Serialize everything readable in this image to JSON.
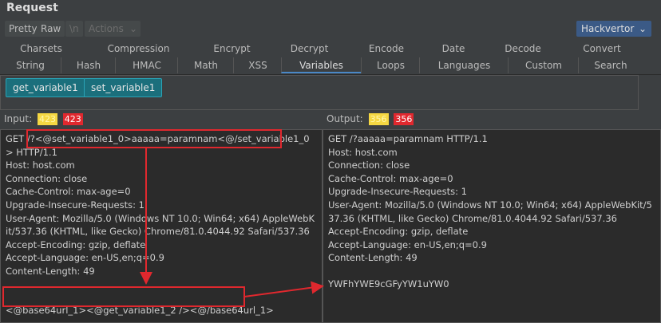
{
  "title": "Request",
  "toolbar": {
    "pretty": "Pretty",
    "raw": "Raw",
    "newline": "\\n",
    "actions": "Actions",
    "hackvertor": "Hackvertor"
  },
  "tabs_row1": [
    "Charsets",
    "Compression",
    "Encrypt",
    "Decrypt",
    "Encode",
    "Date",
    "Decode",
    "Convert"
  ],
  "tabs_row2": [
    "String",
    "Hash",
    "HMAC",
    "Math",
    "XSS",
    "Variables",
    "Loops",
    "Languages",
    "Custom",
    "Search"
  ],
  "active_tab": "Variables",
  "variables": {
    "get": "get_variable1",
    "set": "set_variable1"
  },
  "input": {
    "label": "Input:",
    "count1": "423",
    "count2": "423",
    "lines": [
      "GET /?<@set_variable1_0>aaaaa=paramnam<@/set_variable1_0> HTTP/1.1",
      "Host: host.com",
      "Connection: close",
      "Cache-Control: max-age=0",
      "Upgrade-Insecure-Requests: 1",
      "User-Agent: Mozilla/5.0 (Windows NT 10.0; Win64; x64) AppleWebKit/537.36 (KHTML, like Gecko) Chrome/81.0.4044.92 Safari/537.36",
      "Accept-Encoding: gzip, deflate",
      "Accept-Language: en-US,en;q=0.9",
      "Content-Length: 49",
      "",
      "<@base64url_1><@get_variable1_2 /><@/base64url_1>"
    ]
  },
  "output": {
    "label": "Output:",
    "count1": "356",
    "count2": "356",
    "lines": [
      "GET /?aaaaa=paramnam HTTP/1.1",
      "Host: host.com",
      "Connection: close",
      "Cache-Control: max-age=0",
      "Upgrade-Insecure-Requests: 1",
      "User-Agent: Mozilla/5.0 (Windows NT 10.0; Win64; x64) AppleWebKit/537.36 (KHTML, like Gecko) Chrome/81.0.4044.92 Safari/537.36",
      "Accept-Encoding: gzip, deflate",
      "Accept-Language: en-US,en;q=0.9",
      "Content-Length: 49",
      "",
      "YWFhYWE9cGFyYW1uYW0"
    ]
  },
  "colors": {
    "accent": "#4a88c7",
    "annotation": "#e0282e",
    "variable_button": "#1b6f7c"
  },
  "icons": {
    "actions_dropdown": "chevron-down-icon",
    "hackvertor_dropdown": "chevron-down-icon"
  }
}
